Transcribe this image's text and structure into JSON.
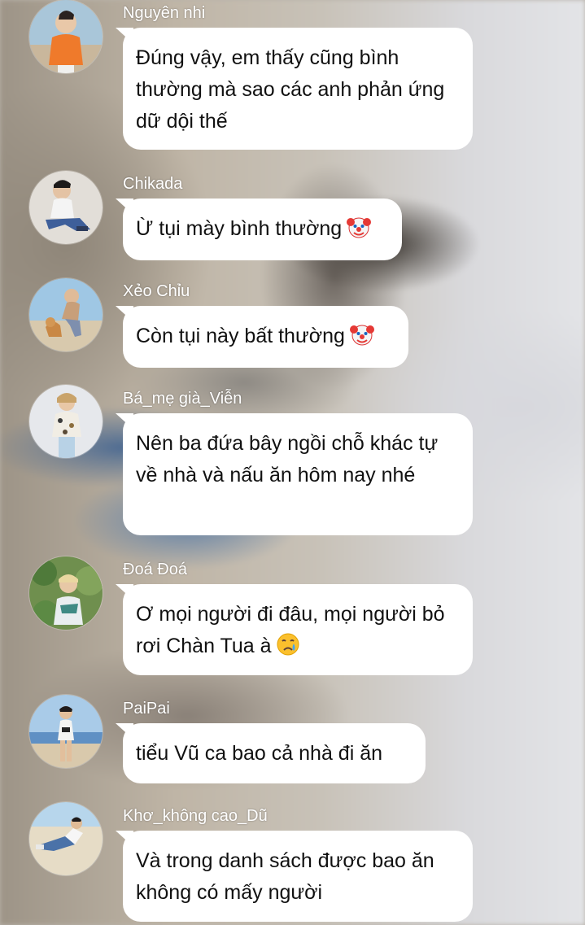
{
  "messages": [
    {
      "sender": "Nguyên nhi",
      "text": "Đúng vậy, em thấy cũng bình thường mà sao các anh phản ứng dữ dội thế",
      "avatar_icon": "person-orange-shirt-avatar"
    },
    {
      "sender": "Chikada",
      "text": "Ừ tụi mày bình thường",
      "emoji": "clown-face",
      "avatar_icon": "person-sitting-avatar"
    },
    {
      "sender": "Xẻo Chỉu",
      "text": "Còn tụi này bất thường",
      "emoji": "clown-face",
      "avatar_icon": "person-with-dog-avatar"
    },
    {
      "sender": "Bá_mẹ già_Viễn",
      "text": "Nên ba đứa bây ngồi chỗ khác tự về nhà và nấu ăn hôm nay nhé",
      "avatar_icon": "person-floral-shirt-avatar"
    },
    {
      "sender": "Đoá Đoá",
      "text": "Ơ mọi người đi đâu, mọi người bỏ rơi Chàn Tua à",
      "emoji": "crying-face",
      "avatar_icon": "person-in-foliage-avatar"
    },
    {
      "sender": "PaiPai",
      "text": "tiểu Vũ ca bao cả nhà đi ăn",
      "avatar_icon": "person-beach-avatar"
    },
    {
      "sender": "Khơ_không cao_Dũ",
      "text": "Và trong danh sách được bao ăn không có mấy người",
      "avatar_icon": "person-lying-sand-avatar"
    }
  ],
  "colors": {
    "bubble": "#ffffff",
    "name_text": "#ffffff",
    "message_text": "#111111"
  }
}
